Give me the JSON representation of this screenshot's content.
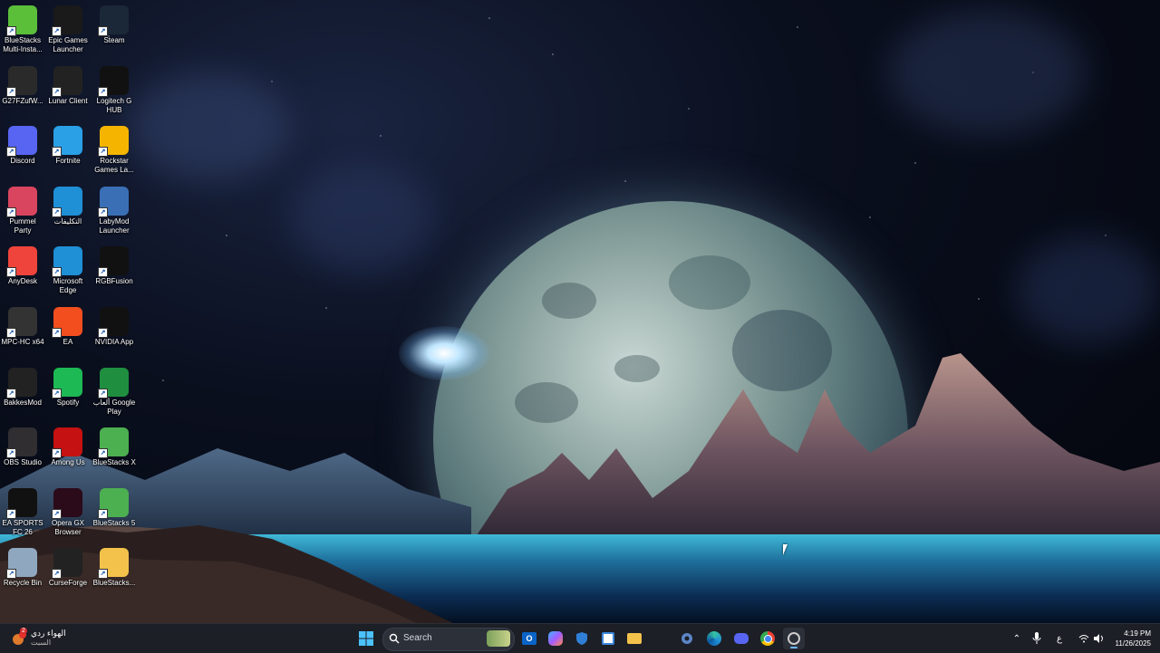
{
  "desktop": {
    "icons": [
      {
        "label": "BlueStacks Multi-Insta...",
        "icon": "bluestacks-multi-icon",
        "color": "#5bbf3a"
      },
      {
        "label": "Epic Games Launcher",
        "icon": "epic-games-icon",
        "color": "#1a1a1a"
      },
      {
        "label": "Steam",
        "icon": "steam-icon",
        "color": "#1b2838"
      },
      {
        "label": "G27FZufW...",
        "icon": "cinema-file-icon",
        "color": "#2a2a2a"
      },
      {
        "label": "Lunar Client",
        "icon": "lunar-client-icon",
        "color": "#222"
      },
      {
        "label": "Logitech G HUB",
        "icon": "logitech-g-icon",
        "color": "#111"
      },
      {
        "label": "Discord",
        "icon": "discord-icon",
        "color": "#5865f2"
      },
      {
        "label": "Fortnite",
        "icon": "fortnite-icon",
        "color": "#2aa0e6"
      },
      {
        "label": "Rockstar Games La...",
        "icon": "rockstar-icon",
        "color": "#f4b400"
      },
      {
        "label": "Pummel Party",
        "icon": "pummel-party-icon",
        "color": "#d9455f"
      },
      {
        "label": "التكليفات",
        "icon": "edge-shortcut-icon",
        "color": "#1f8fd6"
      },
      {
        "label": "LabyMod Launcher",
        "icon": "labymod-icon",
        "color": "#3a6fb5"
      },
      {
        "label": "AnyDesk",
        "icon": "anydesk-icon",
        "color": "#ef443b"
      },
      {
        "label": "Microsoft Edge",
        "icon": "edge-icon",
        "color": "#1f8fd6"
      },
      {
        "label": "RGBFusion",
        "icon": "rgbfusion-icon",
        "color": "#111"
      },
      {
        "label": "MPC-HC x64",
        "icon": "mpc-hc-icon",
        "color": "#333"
      },
      {
        "label": "EA",
        "icon": "ea-icon",
        "color": "#f24e1e"
      },
      {
        "label": "NVIDIA App",
        "icon": "nvidia-icon",
        "color": "#111"
      },
      {
        "label": "BakkesMod",
        "icon": "bakkesmod-icon",
        "color": "#222"
      },
      {
        "label": "Spotify",
        "icon": "spotify-icon",
        "color": "#1db954"
      },
      {
        "label": "ألعاب Google Play",
        "icon": "google-play-games-icon",
        "color": "#1f8f3f"
      },
      {
        "label": "OBS Studio",
        "icon": "obs-icon",
        "color": "#302e31"
      },
      {
        "label": "Among Us",
        "icon": "among-us-icon",
        "color": "#c51111"
      },
      {
        "label": "BlueStacks X",
        "icon": "bluestacks-x-icon",
        "color": "#4caf50"
      },
      {
        "label": "EA SPORTS FC 26",
        "icon": "ea-fc26-icon",
        "color": "#111"
      },
      {
        "label": "Opera GX Browser",
        "icon": "opera-gx-icon",
        "color": "#2b0a1a"
      },
      {
        "label": "BlueStacks 5",
        "icon": "bluestacks-5-icon",
        "color": "#4caf50"
      },
      {
        "label": "Recycle Bin",
        "icon": "recycle-bin-icon",
        "color": "#8fa8c0"
      },
      {
        "label": "CurseForge",
        "icon": "curseforge-icon",
        "color": "#222"
      },
      {
        "label": "BlueStacks...",
        "icon": "folder-icon",
        "color": "#f3c24b"
      }
    ]
  },
  "taskbar": {
    "weather": {
      "title": "الهواء ردي",
      "subtitle": "السبت",
      "badge": "2"
    },
    "search_placeholder": "Search",
    "pinned": [
      {
        "name": "start",
        "icon": "windows-icon"
      },
      {
        "name": "outlook",
        "icon": "outlook-icon"
      },
      {
        "name": "copilot",
        "icon": "copilot-icon"
      },
      {
        "name": "defender",
        "icon": "shield-icon"
      },
      {
        "name": "store",
        "icon": "store-icon"
      },
      {
        "name": "explorer",
        "icon": "folder-icon"
      },
      {
        "name": "settings-lang",
        "icon": "settings-icon"
      },
      {
        "name": "edge",
        "icon": "edge-icon"
      },
      {
        "name": "discord",
        "icon": "discord-icon"
      },
      {
        "name": "chrome",
        "icon": "chrome-icon"
      },
      {
        "name": "recorder",
        "icon": "recorder-icon"
      }
    ],
    "tray": {
      "language": "ع",
      "time": "4:19 PM",
      "date": "11/26/2025"
    }
  }
}
